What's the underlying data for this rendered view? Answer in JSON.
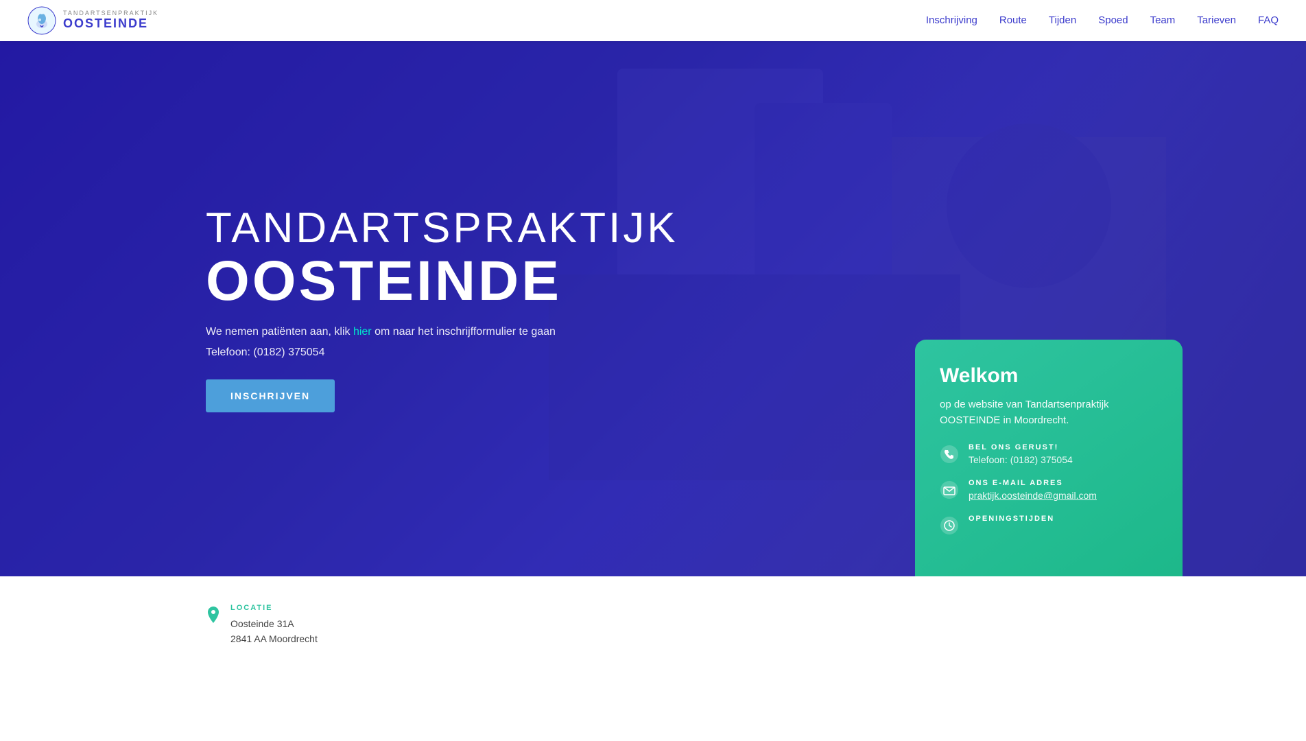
{
  "navbar": {
    "logo": {
      "small_text": "TANDARTSENPRAKTIJK",
      "big_text": "OOSTEINDE"
    },
    "nav_items": [
      {
        "label": "Inschrijving",
        "id": "nav-inschrijving"
      },
      {
        "label": "Route",
        "id": "nav-route"
      },
      {
        "label": "Tijden",
        "id": "nav-tijden"
      },
      {
        "label": "Spoed",
        "id": "nav-spoed"
      },
      {
        "label": "Team",
        "id": "nav-team"
      },
      {
        "label": "Tarieven",
        "id": "nav-tarieven"
      },
      {
        "label": "FAQ",
        "id": "nav-faq"
      }
    ]
  },
  "hero": {
    "title_light": "TANDARTSPRAKTIJK",
    "title_bold": "OOSTEINDE",
    "subtitle": "We nemen patiënten aan, klik ",
    "subtitle_link": "hier",
    "subtitle_rest": " om naar het inschrijfformulier te gaan",
    "phone_label": "Telefoon: (0182) 375054",
    "cta_button": "INSCHRIJVEN"
  },
  "welkom_card": {
    "title": "Welkom",
    "description": "op de website van Tandartsenpraktijk OOSTEINDE in Moordrecht.",
    "items": [
      {
        "icon": "phone",
        "label": "BEL ONS GERUST!",
        "value": "Telefoon: (0182) 375054"
      },
      {
        "icon": "email",
        "label": "ONS E-MAIL ADRES",
        "value": "praktijk.oosteinde@gmail.com"
      },
      {
        "icon": "clock",
        "label": "OPENINGSTIJDEN",
        "value": ""
      }
    ]
  },
  "footer": {
    "location_label": "LOCATIE",
    "location_address_1": "Oosteinde 31A",
    "location_address_2": "2841 AA Moordrecht"
  }
}
